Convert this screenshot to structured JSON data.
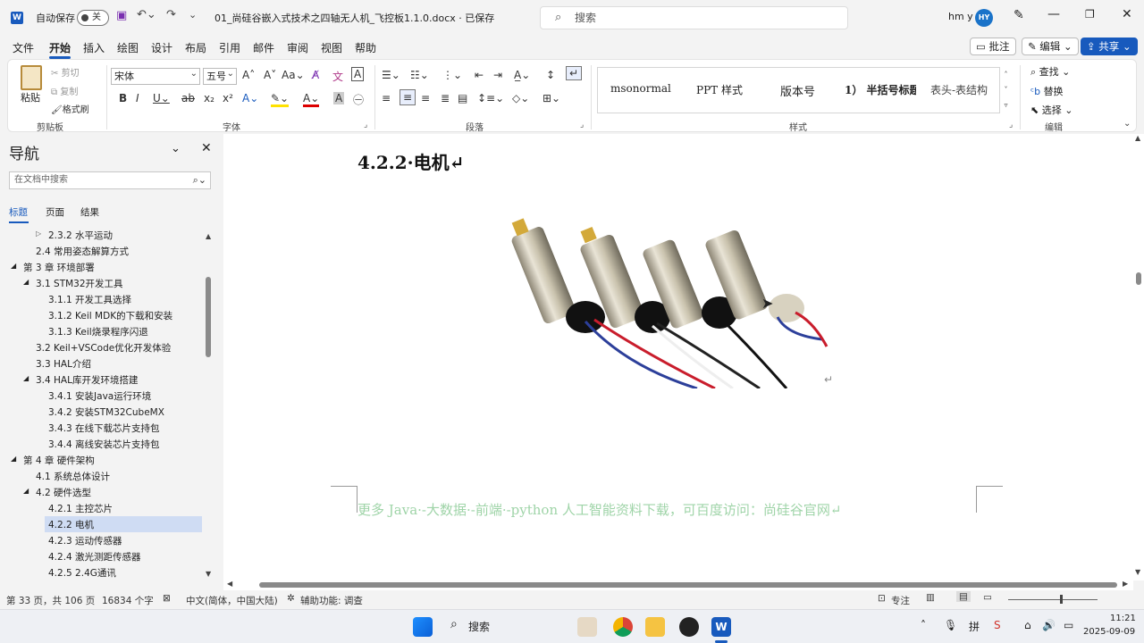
{
  "titlebar": {
    "autosave_label": "自动保存",
    "autosave_state": "关",
    "filename": "01_尚硅谷嵌入式技术之四轴无人机_飞控板1.1.0.docx · 已保存",
    "search_placeholder": "搜索",
    "user_name": "hm y",
    "avatar_initials": "HY"
  },
  "menu": {
    "tabs": [
      "文件",
      "开始",
      "插入",
      "绘图",
      "设计",
      "布局",
      "引用",
      "邮件",
      "审阅",
      "视图",
      "帮助"
    ],
    "comment_btn": "批注",
    "edit_btn": "编辑",
    "share_btn": "共享"
  },
  "ribbon": {
    "clipboard": {
      "paste": "粘贴",
      "cut": "剪切",
      "copy": "复制",
      "format_painter": "格式刷",
      "group": "剪贴板"
    },
    "font": {
      "font_name": "宋体",
      "font_size": "五号",
      "group": "字体"
    },
    "paragraph": {
      "group": "段落"
    },
    "styles": {
      "items": [
        "msonormal",
        "PPT 样式",
        "版本号",
        "1） 半括号标题",
        "表头-表结构"
      ],
      "group": "样式"
    },
    "editing": {
      "find": "查找",
      "replace": "替换",
      "select": "选择",
      "group": "编辑"
    }
  },
  "nav": {
    "title": "导航",
    "search_placeholder": "在文档中搜索",
    "tabs": [
      "标题",
      "页面",
      "结果"
    ],
    "items": [
      "2.3.2 水平运动",
      "2.4 常用姿态解算方式",
      "第 3 章 环境部署",
      "3.1 STM32开发工具",
      "3.1.1 开发工具选择",
      "3.1.2 Keil MDK的下载和安装",
      "3.1.3 Keil烧录程序闪退",
      "3.2 Keil+VSCode优化开发体验",
      "3.3 HAL介绍",
      "3.4 HAL库开发环境搭建",
      "3.4.1 安装Java运行环境",
      "3.4.2 安装STM32CubeMX",
      "3.4.3 在线下载芯片支持包",
      "3.4.4 离线安装芯片支持包",
      "第 4 章 硬件架构",
      "4.1 系统总体设计",
      "4.2 硬件选型",
      "4.2.1 主控芯片",
      "4.2.2 电机",
      "4.2.3 运动传感器",
      "4.2.4 激光测距传感器",
      "4.2.5 2.4G通讯"
    ],
    "selected": "4.2.2 电机"
  },
  "document": {
    "heading": "4.2.2·电机↵",
    "footer_text": "更多 Java·-大数据·-前端·-python 人工智能资料下载，可百度访问：尚硅谷官网↵",
    "return_mark": "↵"
  },
  "status": {
    "page": "第 33 页，共 106 页",
    "words": "16834 个字",
    "language": "中文(简体，中国大陆)",
    "accessibility": "辅助功能: 调查",
    "focus": "专注"
  },
  "taskbar": {
    "search": "搜索",
    "time": "11:21",
    "date": "2025-09-09"
  },
  "colors": {
    "accent": "#185abd",
    "footer_green": "#9fd4a8"
  }
}
